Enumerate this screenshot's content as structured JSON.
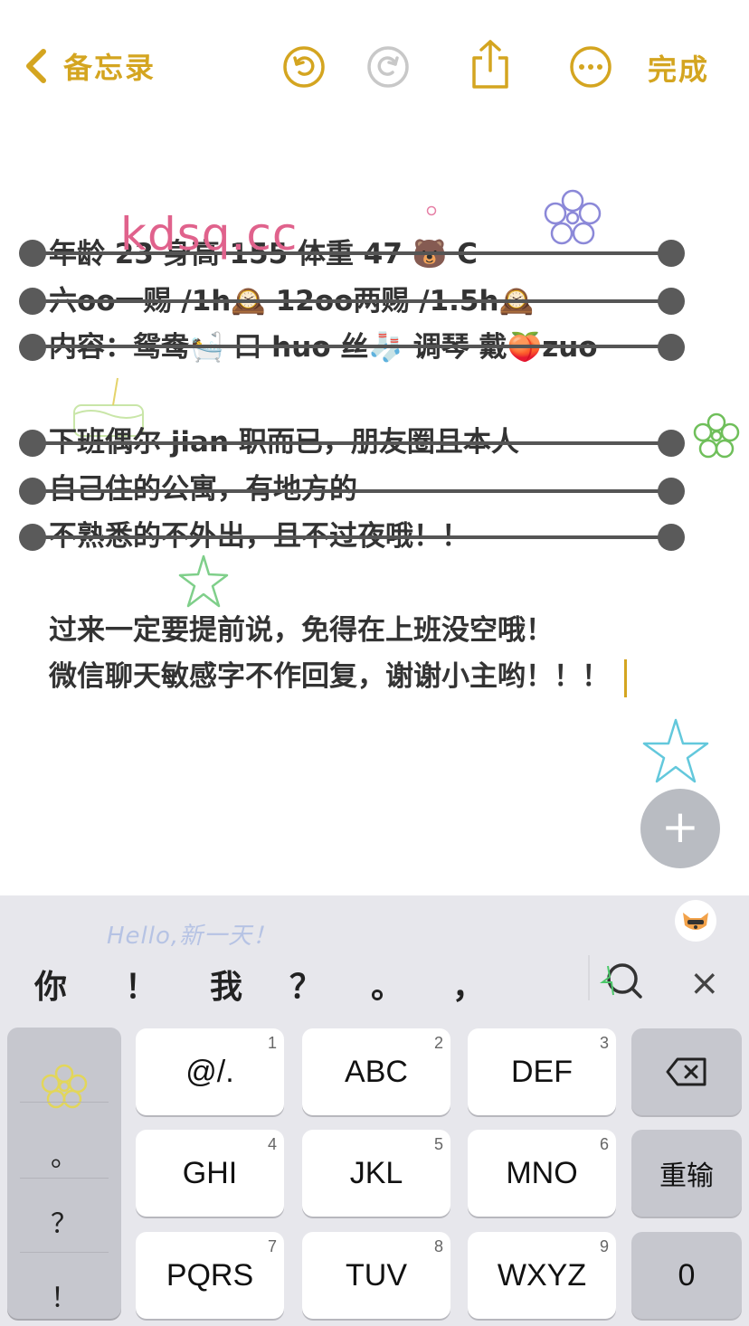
{
  "nav": {
    "back_label": "备忘录",
    "done_label": "完成",
    "accent_color": "#d4a520",
    "icons": [
      "chevron-left-icon",
      "undo-icon",
      "redo-icon",
      "share-icon",
      "more-icon"
    ]
  },
  "watermark": "kdsq.cc",
  "note": {
    "struck_lines": [
      "年龄 23 身高 155 体重 47 🐻 C",
      "六oo一赐 /1h🕰️  12oo两赐 /1.5h🕰️",
      "内容：鸳鸯🛀 口 huo 丝🧦 调琴 戴🍑zuo",
      "下班偶尔 jian 职而已，朋友圈且本人",
      "自己住的公寓，有地方的",
      "不熟悉的不外出，且不过夜哦！！"
    ],
    "plain_lines": [
      "过来一定要提前说，免得在上班没空哦！",
      "微信聊天敏感字不作回复，谢谢小主哟！！！"
    ]
  },
  "fab": {
    "label": "+"
  },
  "keyboard": {
    "greeting": "Hello,新一天！",
    "candidates": [
      "你",
      "！",
      "我",
      "？",
      "。",
      "，"
    ],
    "side_column": [
      "。",
      "？",
      "！"
    ],
    "keys": [
      {
        "label": "@/.",
        "num": "1"
      },
      {
        "label": "ABC",
        "num": "2"
      },
      {
        "label": "DEF",
        "num": "3"
      },
      {
        "label": "GHI",
        "num": "4"
      },
      {
        "label": "JKL",
        "num": "5"
      },
      {
        "label": "MNO",
        "num": "6"
      },
      {
        "label": "PQRS",
        "num": "7"
      },
      {
        "label": "TUV",
        "num": "8"
      },
      {
        "label": "WXYZ",
        "num": "9"
      }
    ],
    "retype_label": "重输",
    "zero_label": "0",
    "close_label": "×"
  }
}
